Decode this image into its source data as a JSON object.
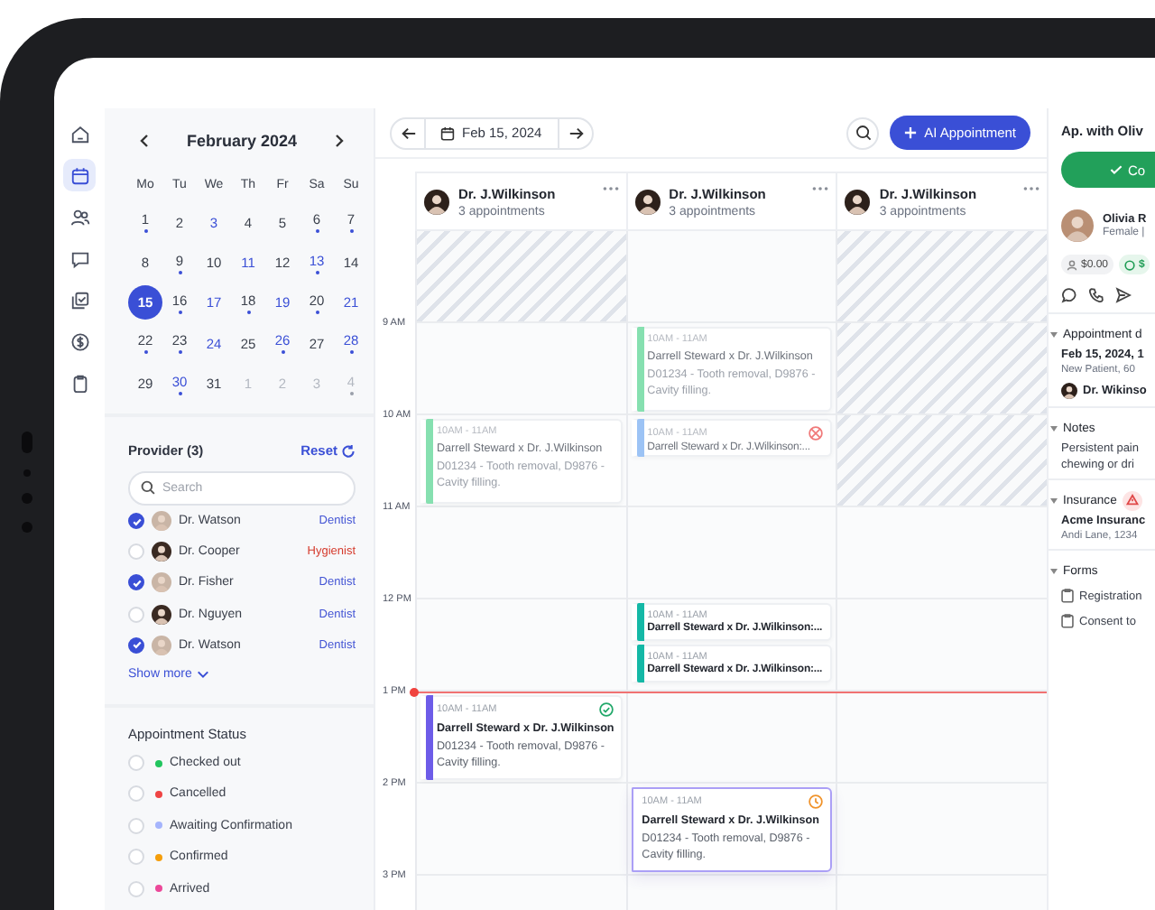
{
  "nav": [
    {
      "kind": "home",
      "selected": false
    },
    {
      "kind": "calendar",
      "selected": true
    },
    {
      "kind": "patients",
      "selected": false
    },
    {
      "kind": "messages",
      "selected": false
    },
    {
      "kind": "documents",
      "selected": false
    },
    {
      "kind": "billing",
      "selected": false
    },
    {
      "kind": "clipboard",
      "selected": false
    }
  ],
  "mini_calendar": {
    "month": "February 2024",
    "weekdays": [
      "Mo",
      "Tu",
      "We",
      "Th",
      "Fr",
      "Sa",
      "Su"
    ],
    "weeks": [
      [
        {
          "day": "1",
          "highlighted": false,
          "dot": true,
          "selected": false,
          "muted": false
        },
        {
          "day": "2",
          "highlighted": false,
          "dot": false,
          "selected": false,
          "muted": false
        },
        {
          "day": "3",
          "highlighted": true,
          "dot": false,
          "selected": false,
          "muted": false
        },
        {
          "day": "4",
          "highlighted": false,
          "dot": false,
          "selected": false,
          "muted": false
        },
        {
          "day": "5",
          "highlighted": false,
          "dot": false,
          "selected": false,
          "muted": false
        },
        {
          "day": "6",
          "highlighted": false,
          "dot": true,
          "selected": false,
          "muted": false
        },
        {
          "day": "7",
          "highlighted": false,
          "dot": true,
          "selected": false,
          "muted": false
        }
      ],
      [
        {
          "day": "8",
          "highlighted": false,
          "dot": false,
          "selected": false,
          "muted": false
        },
        {
          "day": "9",
          "highlighted": false,
          "dot": true,
          "selected": false,
          "muted": false
        },
        {
          "day": "10",
          "highlighted": false,
          "dot": false,
          "selected": false,
          "muted": false
        },
        {
          "day": "11",
          "highlighted": true,
          "dot": false,
          "selected": false,
          "muted": false
        },
        {
          "day": "12",
          "highlighted": false,
          "dot": false,
          "selected": false,
          "muted": false
        },
        {
          "day": "13",
          "highlighted": true,
          "dot": true,
          "selected": false,
          "muted": false
        },
        {
          "day": "14",
          "highlighted": false,
          "dot": false,
          "selected": false,
          "muted": false
        }
      ],
      [
        {
          "day": "15",
          "highlighted": false,
          "dot": false,
          "selected": true,
          "muted": false
        },
        {
          "day": "16",
          "highlighted": false,
          "dot": true,
          "selected": false,
          "muted": false
        },
        {
          "day": "17",
          "highlighted": true,
          "dot": false,
          "selected": false,
          "muted": false
        },
        {
          "day": "18",
          "highlighted": false,
          "dot": true,
          "selected": false,
          "muted": false
        },
        {
          "day": "19",
          "highlighted": true,
          "dot": false,
          "selected": false,
          "muted": false
        },
        {
          "day": "20",
          "highlighted": false,
          "dot": true,
          "selected": false,
          "muted": false
        },
        {
          "day": "21",
          "highlighted": true,
          "dot": false,
          "selected": false,
          "muted": false
        }
      ],
      [
        {
          "day": "22",
          "highlighted": false,
          "dot": true,
          "selected": false,
          "muted": false
        },
        {
          "day": "23",
          "highlighted": false,
          "dot": true,
          "selected": false,
          "muted": false
        },
        {
          "day": "24",
          "highlighted": true,
          "dot": false,
          "selected": false,
          "muted": false
        },
        {
          "day": "25",
          "highlighted": false,
          "dot": false,
          "selected": false,
          "muted": false
        },
        {
          "day": "26",
          "highlighted": true,
          "dot": true,
          "selected": false,
          "muted": false
        },
        {
          "day": "27",
          "highlighted": false,
          "dot": false,
          "selected": false,
          "muted": false
        },
        {
          "day": "28",
          "highlighted": true,
          "dot": true,
          "selected": false,
          "muted": false
        }
      ],
      [
        {
          "day": "29",
          "highlighted": false,
          "dot": false,
          "selected": false,
          "muted": false
        },
        {
          "day": "30",
          "highlighted": true,
          "dot": true,
          "selected": false,
          "muted": false
        },
        {
          "day": "31",
          "highlighted": false,
          "dot": false,
          "selected": false,
          "muted": false
        },
        {
          "day": "1",
          "highlighted": false,
          "dot": false,
          "selected": false,
          "muted": true
        },
        {
          "day": "2",
          "highlighted": false,
          "dot": false,
          "selected": false,
          "muted": true
        },
        {
          "day": "3",
          "highlighted": false,
          "dot": false,
          "selected": false,
          "muted": true
        },
        {
          "day": "4",
          "highlighted": false,
          "dot": true,
          "selected": false,
          "muted": true
        }
      ]
    ]
  },
  "providers": {
    "title": "Provider (3)",
    "reset": "Reset",
    "search_placeholder": "Search",
    "items": [
      {
        "name": "Dr. Watson",
        "role": "Dentist",
        "checked": true,
        "color": "#4354d4"
      },
      {
        "name": "Dr. Cooper",
        "role": "Hygienist",
        "checked": false,
        "color": "#d53a2c"
      },
      {
        "name": "Dr. Fisher",
        "role": "Dentist",
        "checked": true,
        "color": "#4354d4"
      },
      {
        "name": "Dr. Nguyen",
        "role": "Dentist",
        "checked": false,
        "color": "#4354d4"
      },
      {
        "name": "Dr. Watson",
        "role": "Dentist",
        "checked": true,
        "color": "#4354d4"
      }
    ],
    "show_more": "Show more"
  },
  "appointment_status": {
    "title": "Appointment Status",
    "items": [
      {
        "label": "Checked out",
        "checked": false,
        "color": "#22c55e"
      },
      {
        "label": "Cancelled",
        "checked": false,
        "color": "#ef4444"
      },
      {
        "label": "Awaiting Confirmation",
        "checked": false,
        "color": "#a5b4fc"
      },
      {
        "label": "Confirmed",
        "checked": false,
        "color": "#f59e0b"
      },
      {
        "label": "Arrived",
        "checked": false,
        "color": "#ec4899"
      }
    ]
  },
  "toolbar": {
    "date": "Feb 15, 2024",
    "new_button": "AI Appointment"
  },
  "time_labels": [
    "9 AM",
    "10 AM",
    "11 AM",
    "12 PM",
    "1 PM",
    "2 PM",
    "3 PM"
  ],
  "columns": [
    {
      "name": "Dr. J.Wilkinson",
      "subtitle": "3 appointments",
      "slots": [
        {
          "hatched": true
        },
        {
          "hatched": false
        },
        {
          "hatched": false,
          "events": [
            {
              "kind": "plain",
              "time": "10AM - 11AM",
              "title": "Darrell Steward x Dr. J.Wilkinson",
              "details": "D01234 - Tooth removal, D9876 - Cavity filling.",
              "color": "#86e0b0",
              "faded": true,
              "selected": false
            }
          ]
        },
        {
          "hatched": false
        },
        {
          "hatched": false
        },
        {
          "hatched": false,
          "events": [
            {
              "kind": "checked_out",
              "time": "10AM - 11AM",
              "title": "Darrell Steward x Dr. J.Wilkinson",
              "details": "D01234 - Tooth removal, D9876 - Cavity filling.",
              "color": "#6d5ce8",
              "faded": false,
              "selected": false
            }
          ]
        },
        {
          "hatched": false
        },
        {
          "hatched": false
        }
      ]
    },
    {
      "name": "Dr. J.Wilkinson",
      "subtitle": "3 appointments",
      "slots": [
        {
          "hatched": false
        },
        {
          "hatched": false,
          "events": [
            {
              "kind": "plain",
              "time": "10AM - 11AM",
              "title": "Darrell Steward x Dr. J.Wilkinson",
              "details": "D01234 - Tooth removal, D9876 - Cavity filling.",
              "color": "#86e0b0",
              "faded": true,
              "selected": false
            }
          ]
        },
        {
          "hatched": false,
          "events": [
            {
              "kind": "cancelled",
              "time": "10AM - 11AM",
              "title": "Darrell Steward x Dr. J.Wilkinson:...",
              "color": "#9cc3f5",
              "faded": true,
              "selected": false
            }
          ]
        },
        {
          "hatched": false
        },
        {
          "hatched": false,
          "events": [
            {
              "kind": "plain",
              "time": "10AM - 11AM",
              "title": "Darrell Steward x Dr. J.Wilkinson:...",
              "color": "#14b8a6",
              "faded": false,
              "selected": false
            },
            {
              "kind": "plain",
              "time": "10AM - 11AM",
              "title": "Darrell Steward x Dr. J.Wilkinson:...",
              "color": "#14b8a6",
              "faded": false,
              "selected": false
            }
          ]
        },
        {
          "hatched": false
        },
        {
          "hatched": false,
          "events": [
            {
              "kind": "pending",
              "time": "10AM - 11AM",
              "title": "Darrell Steward x Dr. J.Wilkinson",
              "details": "D01234 - Tooth removal, D9876 - Cavity filling.",
              "color": "#ab9ff6",
              "faded": false,
              "selected": true
            }
          ]
        },
        {
          "hatched": false
        }
      ]
    },
    {
      "name": "Dr. J.Wilkinson",
      "subtitle": "3 appointments",
      "slots": [
        {
          "hatched": true
        },
        {
          "hatched": true
        },
        {
          "hatched": true
        },
        {
          "hatched": false
        },
        {
          "hatched": false
        },
        {
          "hatched": false
        },
        {
          "hatched": false
        },
        {
          "hatched": false
        }
      ]
    }
  ],
  "detail_panel": {
    "title": "Ap. with Oliv",
    "confirm_button": "Co",
    "patient": {
      "name": "Olivia R",
      "meta": "Female |",
      "balance": "$0.00",
      "credit": "$"
    },
    "sections": [
      {
        "kind": "appointment",
        "title": "Appointment d",
        "datetime": "Feb 15, 2024, 1",
        "info": "New Patient, 60",
        "provider": "Dr. Wikinso"
      },
      {
        "kind": "notes",
        "title": "Notes",
        "lines": [
          "Persistent pain",
          "chewing or dri"
        ]
      },
      {
        "kind": "insurance",
        "title": "Insurance",
        "warning": true,
        "lines": [
          "Acme Insuranc",
          "Andi Lane, 1234"
        ]
      },
      {
        "kind": "forms",
        "title": "Forms",
        "items": [
          "Registration",
          "Consent to"
        ]
      }
    ]
  }
}
